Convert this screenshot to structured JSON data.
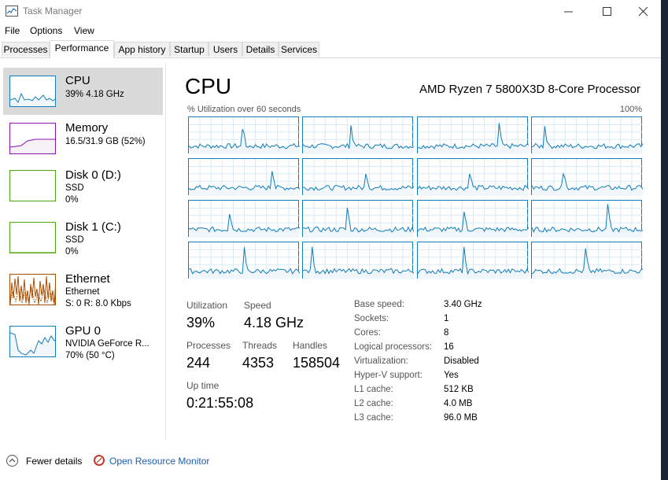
{
  "window": {
    "title": "Task Manager"
  },
  "menu": {
    "file": "File",
    "options": "Options",
    "view": "View"
  },
  "tabs": [
    "Processes",
    "Performance",
    "App history",
    "Startup",
    "Users",
    "Details",
    "Services"
  ],
  "active_tab": "Performance",
  "sidebar": {
    "items": [
      {
        "title": "CPU",
        "line1": "39%  4.18 GHz",
        "line2": "",
        "color": "#117dbb"
      },
      {
        "title": "Memory",
        "line1": "16.5/31.9 GB (52%)",
        "line2": "",
        "color": "#8b12ae"
      },
      {
        "title": "Disk 0 (D:)",
        "line1": "SSD",
        "line2": "0%",
        "color": "#4da60c"
      },
      {
        "title": "Disk 1 (C:)",
        "line1": "SSD",
        "line2": "0%",
        "color": "#4da60c"
      },
      {
        "title": "Ethernet",
        "line1": "Ethernet",
        "line2": "S: 0  R: 8.0 Kbps",
        "color": "#a74f01"
      },
      {
        "title": "GPU 0",
        "line1": "NVIDIA GeForce R...",
        "line2": "70%  (50 °C)",
        "color": "#117dbb"
      }
    ]
  },
  "main": {
    "title": "CPU",
    "model": "AMD Ryzen 7 5800X3D 8-Core Processor",
    "graph_label": "% Utilization over 60 seconds",
    "graph_max": "100%",
    "accent_color": "#117dbb",
    "stats": {
      "utilization_label": "Utilization",
      "utilization": "39%",
      "speed_label": "Speed",
      "speed": "4.18 GHz",
      "processes_label": "Processes",
      "processes": "244",
      "threads_label": "Threads",
      "threads": "4353",
      "handles_label": "Handles",
      "handles": "158504",
      "uptime_label": "Up time",
      "uptime": "0:21:55:08"
    },
    "details": [
      {
        "label": "Base speed:",
        "value": "3.40 GHz"
      },
      {
        "label": "Sockets:",
        "value": "1"
      },
      {
        "label": "Cores:",
        "value": "8"
      },
      {
        "label": "Logical processors:",
        "value": "16"
      },
      {
        "label": "Virtualization:",
        "value": "Disabled"
      },
      {
        "label": "Hyper-V support:",
        "value": "Yes"
      },
      {
        "label": "L1 cache:",
        "value": "512 KB"
      },
      {
        "label": "L2 cache:",
        "value": "4.0 MB"
      },
      {
        "label": "L3 cache:",
        "value": "96.0 MB"
      }
    ]
  },
  "footer": {
    "fewer_details": "Fewer details",
    "resource_monitor": "Open Resource Monitor"
  }
}
